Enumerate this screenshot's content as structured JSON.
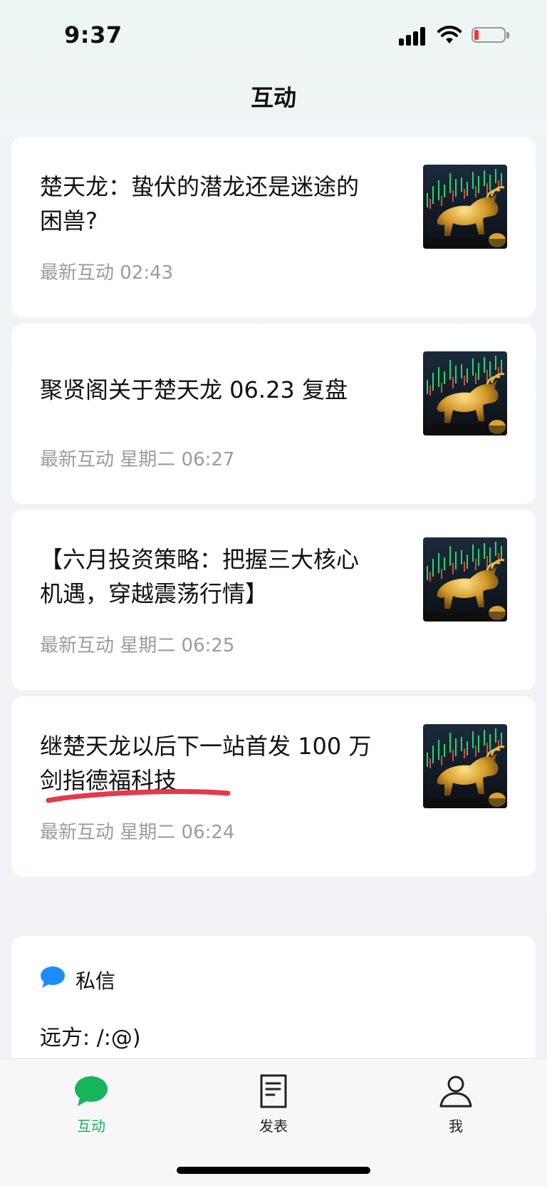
{
  "status_bar": {
    "time": "9:37"
  },
  "page_title": "互动",
  "posts": [
    {
      "title_line1": "楚天龙：蛰伏的潜龙还是迷途的",
      "title_line2": "困兽?",
      "meta": "最新互动 02:43",
      "thumb_icon": "golden-bull-thumbnail"
    },
    {
      "title_line1": "聚贤阁关于楚天龙 06.23 复盘",
      "title_line2": "",
      "meta": "最新互动 星期二 06:27",
      "thumb_icon": "golden-bull-thumbnail"
    },
    {
      "title_line1": "【六月投资策略：把握三大核心",
      "title_line2": "机遇，穿越震荡行情】",
      "meta": "最新互动 星期二 06:25",
      "thumb_icon": "golden-bull-thumbnail"
    },
    {
      "title_line1": "继楚天龙以后下一站首发 100 万",
      "title_line2": "剑指德福科技",
      "meta": "最新互动 星期二 06:24",
      "thumb_icon": "golden-bull-thumbnail"
    }
  ],
  "direct_messages": {
    "header": "私信",
    "preview": "远方: /:@)"
  },
  "tab_bar": {
    "tabs": [
      {
        "label": "互动",
        "icon": "chat-bubble-icon",
        "active": true
      },
      {
        "label": "发表",
        "icon": "document-icon",
        "active": false
      },
      {
        "label": "我",
        "icon": "person-icon",
        "active": false
      }
    ]
  },
  "colors": {
    "accent": "#18b45c",
    "dm_icon": "#1a8cff",
    "annotation_red": "#e5384a",
    "meta_text": "#9b9b9b"
  }
}
